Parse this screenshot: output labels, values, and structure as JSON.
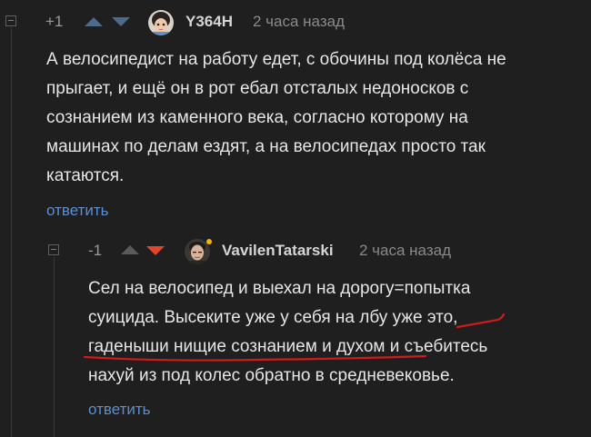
{
  "comments": [
    {
      "rating": "+1",
      "username": "Y364H",
      "time": "2 часа назад",
      "lines": [
        "А велосипедист на работу едет, с обочины под колёса не",
        "прыгает, и ещё он в рот ебал отсталых недоносков с",
        "сознанием из каменного века, согласно которому на",
        "машинах по делам ездят, а на велосипедах просто так",
        "катаются."
      ],
      "reply_label": "ответить"
    },
    {
      "rating": "-1",
      "username": "VavilenTatarski",
      "time": "2 часа назад",
      "lines": [
        "Сел на велосипед и выехал на дорогу=попытка",
        "суицида. Высеките уже у себя на лбу уже это,",
        "гаденыши нищие сознанием и духом и съебитесь",
        "нахуй из под колес обратно в средневековье."
      ],
      "reply_label": "ответить"
    }
  ],
  "colors": {
    "background": "#1f1f1f",
    "link": "#5b8fcf",
    "downvote_active": "#e2452a",
    "underline_annotation": "#d11a1a",
    "online_dot": "#f5b800"
  }
}
